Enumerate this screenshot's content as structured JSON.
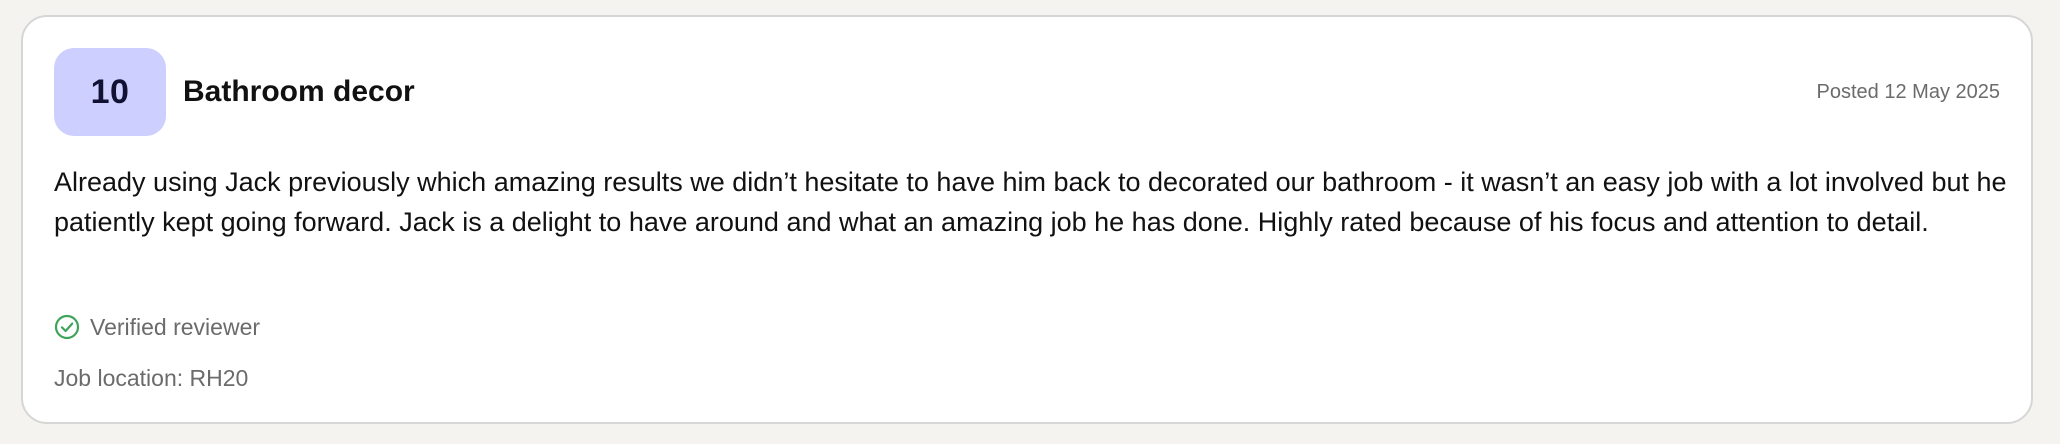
{
  "review": {
    "score": "10",
    "title": "Bathroom decor",
    "posted": "Posted 12 May 2025",
    "body": "Already using Jack previously which amazing results we didn’t hesitate to have him back to decorated our bathroom - it wasn’t an easy job with a lot involved but he patiently kept going forward. Jack is a delight to have around and what an amazing job he has done. Highly rated because of his focus and attention to detail.",
    "verified_label": "Verified reviewer",
    "verified_icon": "check-circle-icon",
    "location": "Job location: RH20"
  },
  "colors": {
    "badge_bg": "#cdd0ff",
    "verified_green": "#3fa35b",
    "muted_text": "#6b6b6b"
  }
}
